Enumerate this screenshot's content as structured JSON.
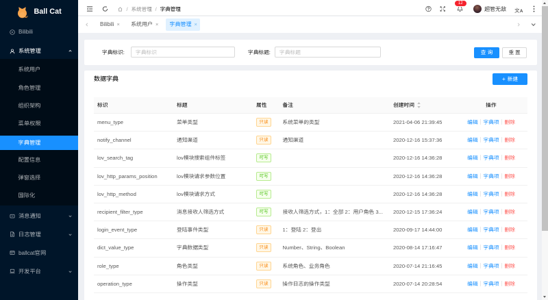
{
  "app": {
    "logo_text": "Ball Cat",
    "accent_color": "#1890ff",
    "selected_color": "#1890ff"
  },
  "sidebar": {
    "items": {
      "bilibili": "Bilibili",
      "system": "系统管理",
      "sub": [
        "系统用户",
        "角色管理",
        "组织架构",
        "菜单权限",
        "字典管理",
        "配置信息",
        "弹窗选择",
        "国际化"
      ],
      "notice": "消息通知",
      "log": "日志管理",
      "site": "ballcat官网",
      "dev": "开发平台"
    }
  },
  "topbar": {
    "breadcrumb": {
      "parent": "系统管理",
      "current": "字典管理"
    },
    "notification_count": "12",
    "username": "超管无敌"
  },
  "tabs": [
    {
      "label": "Bilibili"
    },
    {
      "label": "系统用户"
    },
    {
      "label": "字典管理"
    }
  ],
  "search": {
    "id_label": "字典标识:",
    "id_placeholder": "字典标识",
    "title_label": "字典标题:",
    "title_placeholder": "字典标题",
    "submit_label": "查 询",
    "reset_label": "重 置"
  },
  "card": {
    "title": "数据字典",
    "create_label": "新建"
  },
  "table": {
    "headers": [
      "标识",
      "标题",
      "属性",
      "备注",
      "创建时间",
      "操作"
    ],
    "ops": {
      "edit": "编辑",
      "items": "字典项",
      "delete": "删除"
    },
    "tag_colors": {
      "readonly": "#fa8c16",
      "writable": "#52c41a"
    },
    "rows": [
      {
        "code": "menu_type",
        "title": "菜单类型",
        "attr_label": "只读",
        "attr_variant": "readonly",
        "remark": "系统菜单的类型",
        "created": "2021-04-06 21:39:45"
      },
      {
        "code": "notify_channel",
        "title": "通知渠道",
        "attr_label": "只读",
        "attr_variant": "readonly",
        "remark": "通知渠道",
        "created": "2020-12-16 15:37:36"
      },
      {
        "code": "lov_search_tag",
        "title": "lov模块搜索组件标签",
        "attr_label": "可写",
        "attr_variant": "writable",
        "remark": "",
        "created": "2020-12-16 14:36:28"
      },
      {
        "code": "lov_http_params_position",
        "title": "lov模块请求参数位置",
        "attr_label": "可写",
        "attr_variant": "writable",
        "remark": "",
        "created": "2020-12-16 14:36:28"
      },
      {
        "code": "lov_http_method",
        "title": "lov模块请求方式",
        "attr_label": "可写",
        "attr_variant": "writable",
        "remark": "",
        "created": "2020-12-16 14:36:28"
      },
      {
        "code": "recipient_filter_type",
        "title": "消息接收人筛选方式",
        "attr_label": "可写",
        "attr_variant": "writable",
        "remark": "接收人筛选方式，1：全部 2：用户角色 3...",
        "created": "2020-12-15 17:36:24"
      },
      {
        "code": "login_event_type",
        "title": "登陆事件类型",
        "attr_label": "只读",
        "attr_variant": "readonly",
        "remark": "1：登陆 2：登出",
        "created": "2020-09-17 14:44:00"
      },
      {
        "code": "dict_value_type",
        "title": "字典数据类型",
        "attr_label": "只读",
        "attr_variant": "readonly",
        "remark": "Number、String、Boolean",
        "created": "2020-08-14 17:16:47"
      },
      {
        "code": "role_type",
        "title": "角色类型",
        "attr_label": "只读",
        "attr_variant": "readonly",
        "remark": "系统角色、业务角色",
        "created": "2020-07-14 21:16:45"
      },
      {
        "code": "operation_type",
        "title": "操作类型",
        "attr_label": "只读",
        "attr_variant": "readonly",
        "remark": "操作日志的操作类型",
        "created": "2020-07-14 20:28:54"
      }
    ]
  }
}
